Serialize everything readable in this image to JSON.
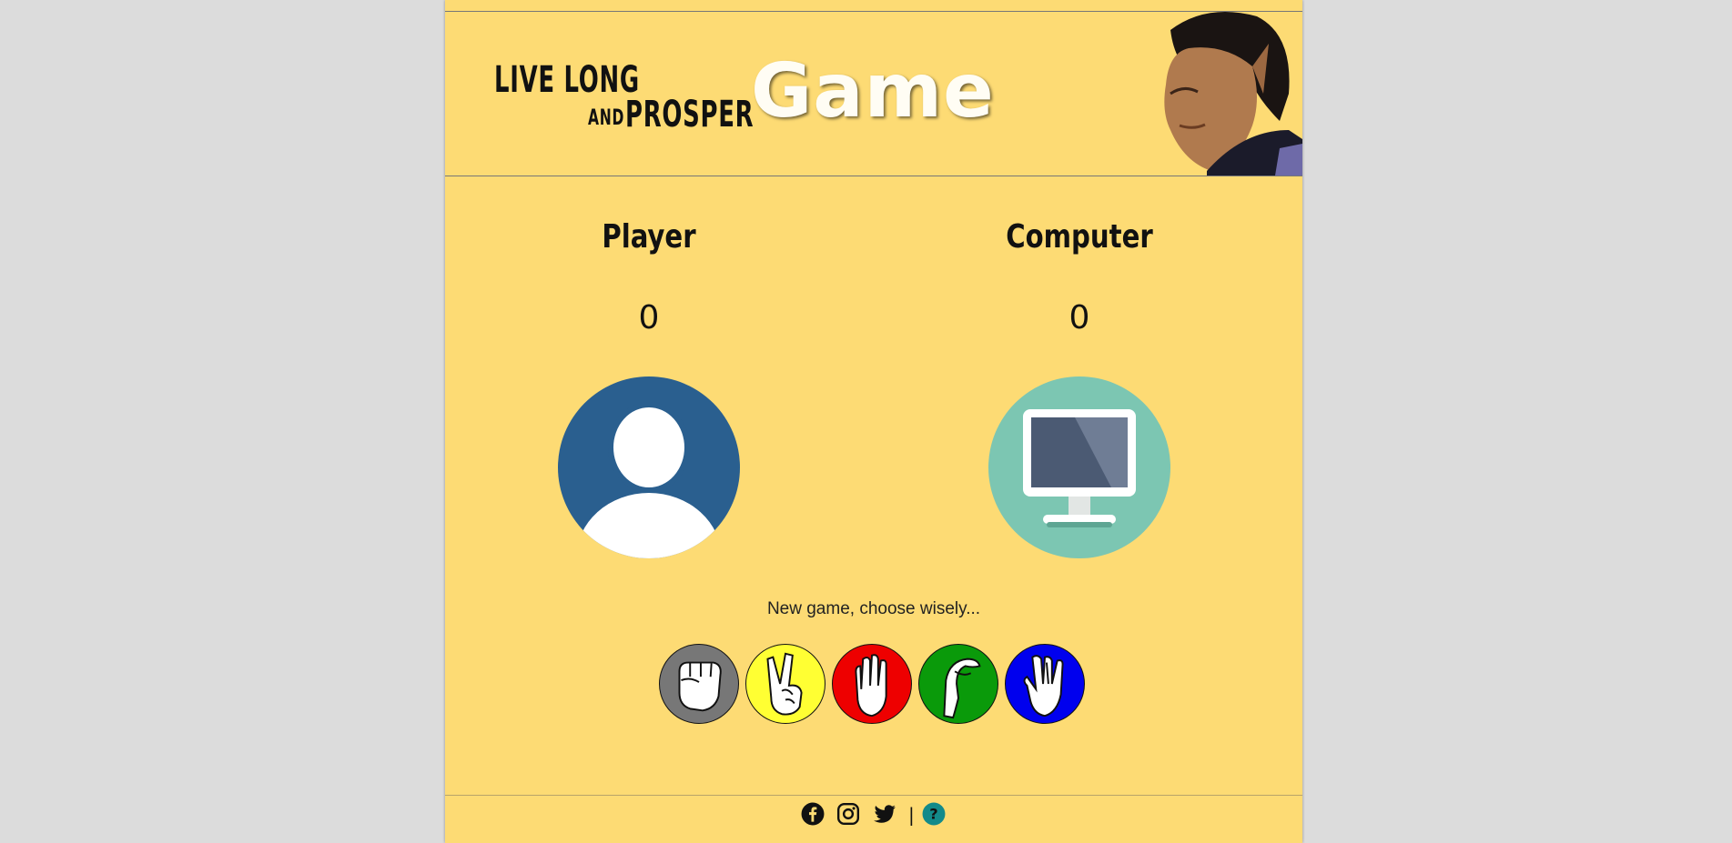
{
  "header": {
    "logo_line1": "LIVE LONG",
    "logo_and": "AND",
    "logo_line2": "PROSPER",
    "title": "Game"
  },
  "player": {
    "label": "Player",
    "score": "0"
  },
  "computer": {
    "label": "Computer",
    "score": "0"
  },
  "message": "New game, choose wisely...",
  "choices": [
    {
      "name": "rock",
      "icon": "fist-icon",
      "color": "#777777"
    },
    {
      "name": "scissors",
      "icon": "peace-hand-icon",
      "color": "#ffff33"
    },
    {
      "name": "paper",
      "icon": "open-hand-icon",
      "color": "#ee0000"
    },
    {
      "name": "lizard",
      "icon": "lizard-hand-icon",
      "color": "#0a9a0a"
    },
    {
      "name": "spock",
      "icon": "vulcan-salute-icon",
      "color": "#0000ee"
    }
  ],
  "footer": {
    "icons": [
      "facebook-icon",
      "instagram-icon",
      "twitter-icon",
      "help-icon"
    ],
    "divider": "|",
    "help_symbol": "?"
  },
  "colors": {
    "background": "#fddb74",
    "outer": "#dcdcdc",
    "player_avatar": "#2a5f8f",
    "computer_avatar": "#7cc6b2",
    "help_icon": "#138a8a"
  }
}
